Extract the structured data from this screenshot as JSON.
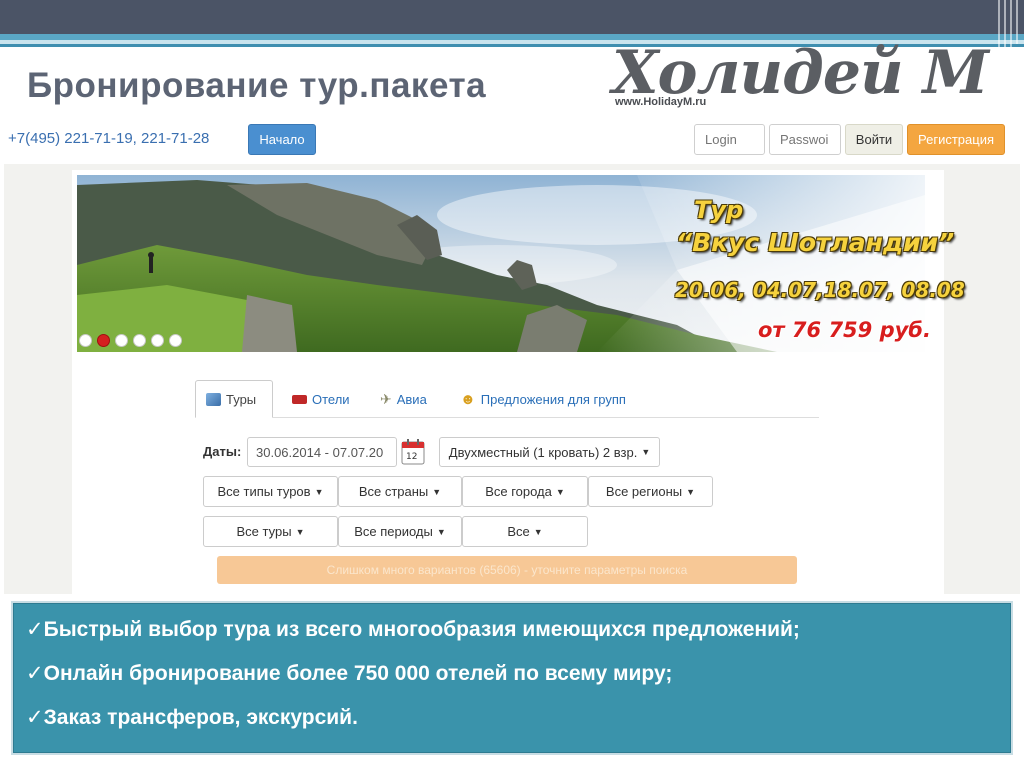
{
  "slide": {
    "title": "Бронирование тур.пакета"
  },
  "logo": {
    "name": "Холидей М",
    "url": "www.HolidayM.ru"
  },
  "site_header": {
    "phone": "+7(495) 221-71-19, 221-71-28",
    "home_button": "Начало",
    "login_placeholder": "Login",
    "password_placeholder": "Passwoi",
    "login_button": "Войти",
    "register_button": "Регистрация"
  },
  "banner": {
    "line1": "Тур",
    "line2": "“Вкус Шотландии”",
    "line3": "20.06, 04.07,18.07, 08.08",
    "line4": "от  76 759 руб.",
    "slides_total": 6,
    "active_slide": 2
  },
  "tabs": [
    {
      "label": "Туры",
      "icon": "package-icon",
      "active": true
    },
    {
      "label": "Отели",
      "icon": "bed-icon",
      "active": false
    },
    {
      "label": "Авиа",
      "icon": "plane-icon",
      "active": false
    },
    {
      "label": "Предложения для групп",
      "icon": "group-icon",
      "active": false
    }
  ],
  "search_form": {
    "dates_label": "Даты:",
    "dates_value": "30.06.2014 - 07.07.20",
    "room_value": "Двухместный (1 кровать) 2 взр.",
    "filters_row1": [
      "Все типы туров",
      "Все страны",
      "Все города",
      "Все регионы"
    ],
    "filters_row2": [
      "Все туры",
      "Все периоды",
      "Все"
    ],
    "warning": "Слишком много вариантов (65606) - уточните параметры поиска"
  },
  "bullets": [
    "Быстрый выбор тура из всего многообразия имеющихся предложений;",
    "Онлайн бронирование более 750 000 отелей по всему миру;",
    "Заказ трансферов, экскурсий."
  ],
  "colors": {
    "header_dark": "#4b5466",
    "accent_blue": "#3a93ab",
    "home_button": "#4a8fd0",
    "register_button": "#f4a640",
    "warning_bg": "#f7c896"
  }
}
